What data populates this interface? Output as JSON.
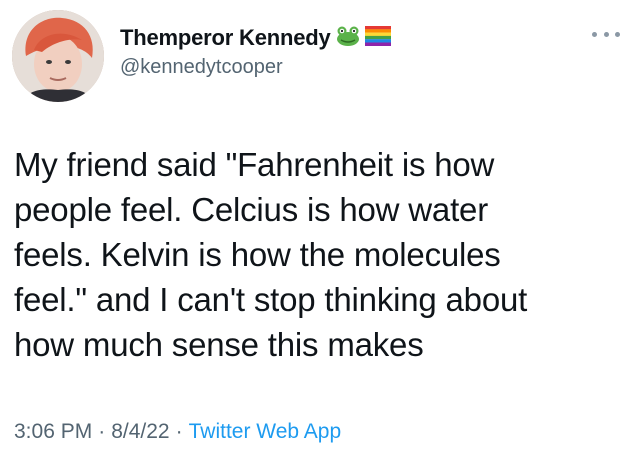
{
  "tweet": {
    "author": {
      "display_name": "Themperor Kennedy",
      "handle": "@kennedytcooper",
      "badges": [
        "frog-emoji-icon",
        "rainbow-flag-icon"
      ]
    },
    "more_icon": "ellipsis-icon",
    "text": "My friend said \"Fahrenheit is how\npeople feel. Celcius is how water\nfeels. Kelvin is how the molecules\nfeel.\" and I can't stop thinking about\nhow much sense this makes",
    "time": "3:06 PM",
    "date": "8/4/22",
    "source": "Twitter Web App",
    "separator": "·"
  },
  "colors": {
    "text_primary": "#0f1419",
    "text_secondary": "#536471",
    "link": "#1d9bf0"
  }
}
